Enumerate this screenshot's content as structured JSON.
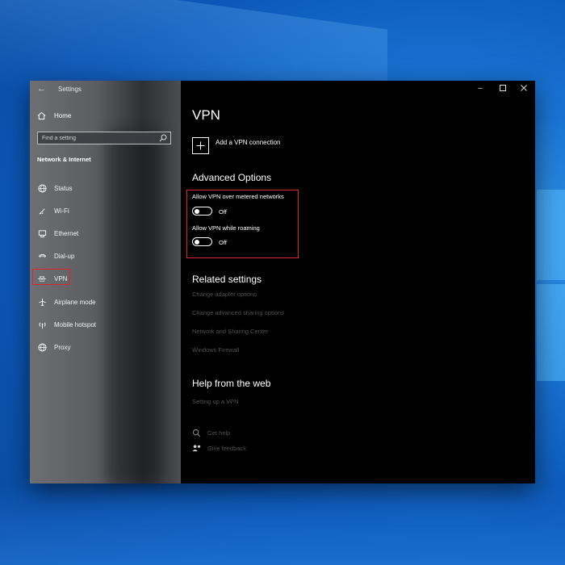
{
  "sidebar": {
    "app_title": "Settings",
    "home_label": "Home",
    "search_placeholder": "Find a setting",
    "section_title": "Network & Internet",
    "items": [
      {
        "label": "Status",
        "icon": "globe-icon"
      },
      {
        "label": "Wi-Fi",
        "icon": "wifi-icon"
      },
      {
        "label": "Ethernet",
        "icon": "ethernet-icon"
      },
      {
        "label": "Dial-up",
        "icon": "dialup-icon"
      },
      {
        "label": "VPN",
        "icon": "vpn-icon",
        "selected": true
      },
      {
        "label": "Airplane mode",
        "icon": "airplane-icon"
      },
      {
        "label": "Mobile hotspot",
        "icon": "hotspot-icon"
      },
      {
        "label": "Proxy",
        "icon": "globe-icon"
      }
    ]
  },
  "main": {
    "title": "VPN",
    "add_connection_label": "Add a VPN connection",
    "advanced_title": "Advanced Options",
    "options": [
      {
        "label": "Allow VPN over metered networks",
        "state": "Off"
      },
      {
        "label": "Allow VPN while roaming",
        "state": "Off"
      }
    ],
    "related_title": "Related settings",
    "related_links": [
      "Change adapter options",
      "Change advanced sharing options",
      "Network and Sharing Center",
      "Windows Firewall"
    ],
    "help_title": "Help from the web",
    "help_links": [
      "Setting up a VPN"
    ],
    "support_items": [
      {
        "label": "Get help",
        "icon": "chat-icon"
      },
      {
        "label": "Give feedback",
        "icon": "feedback-icon"
      }
    ]
  },
  "colors": {
    "highlight": "#e0242b",
    "desktop": "#1a74d4",
    "window_bg": "#000000"
  }
}
